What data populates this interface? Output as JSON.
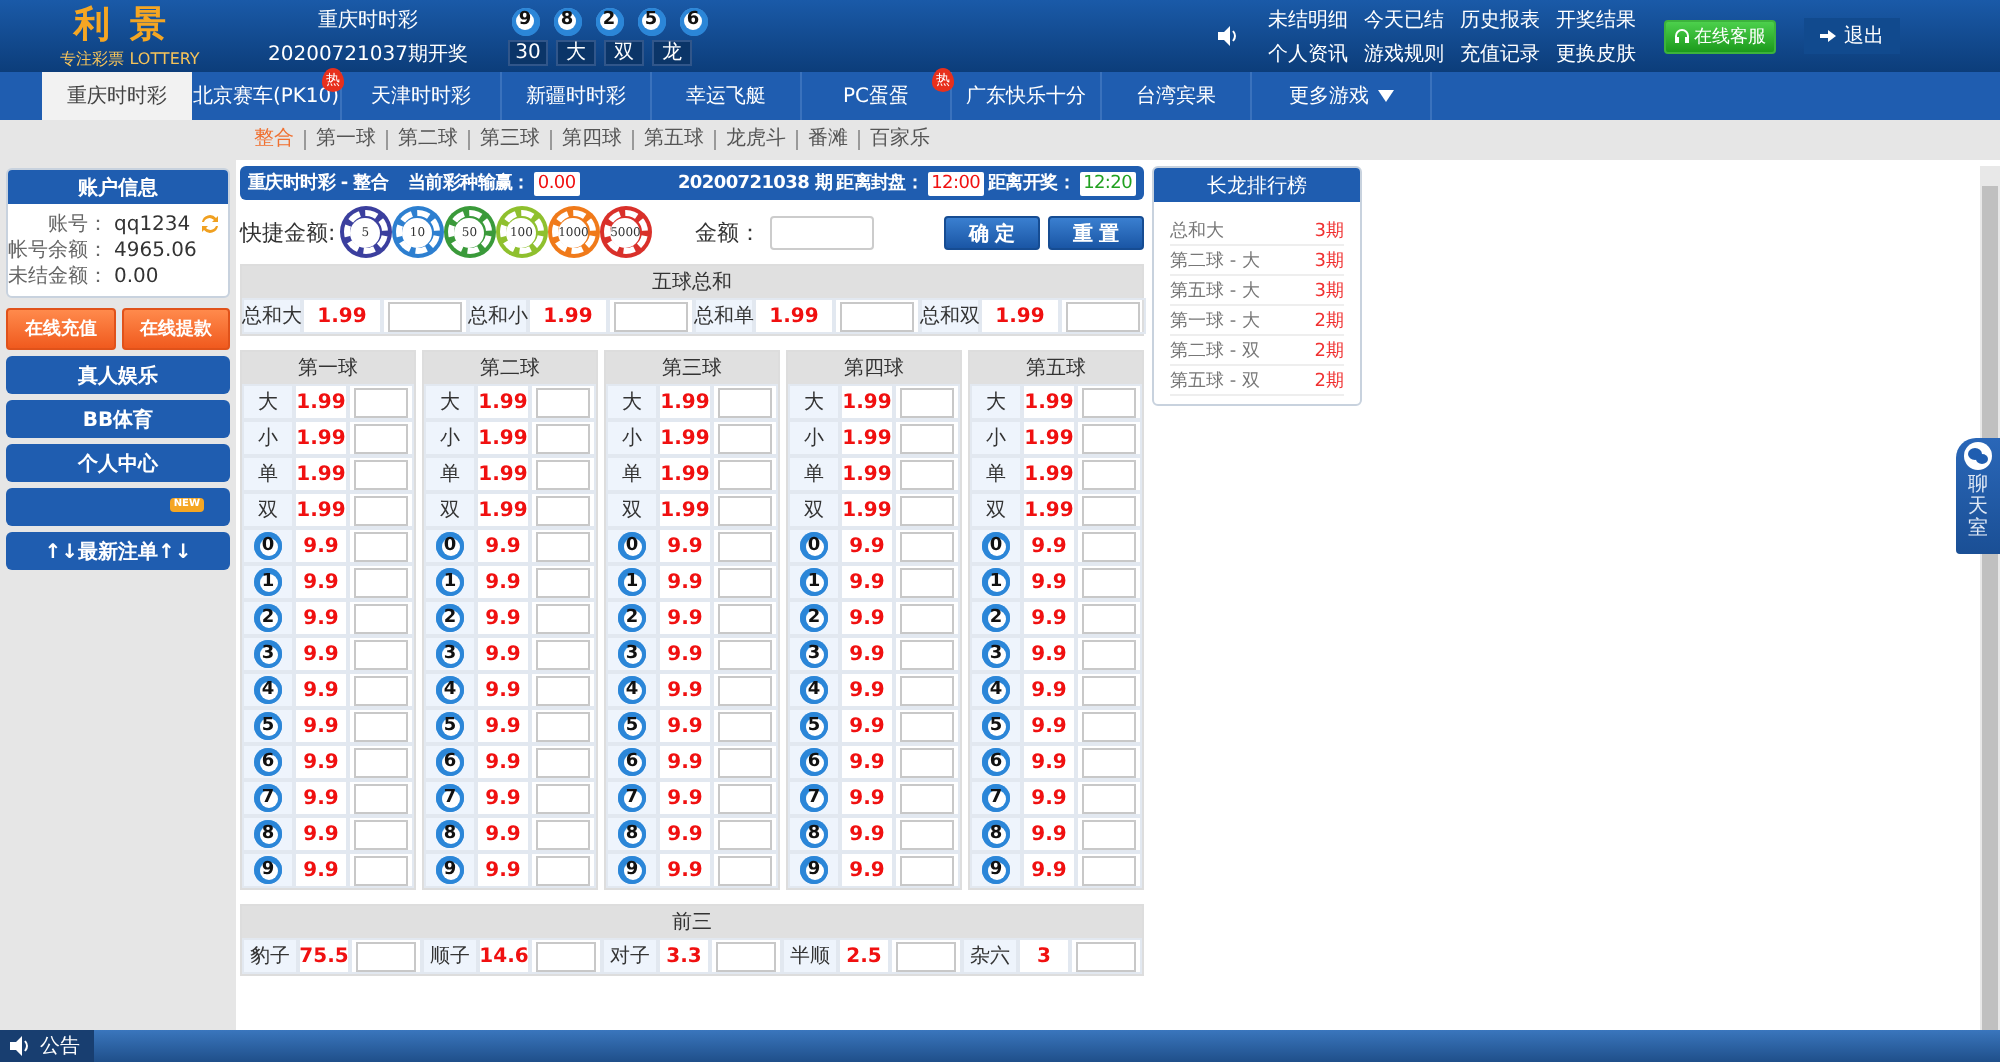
{
  "header": {
    "logo": {
      "title": "利景",
      "tagline": "专注彩票",
      "brand": "LOTTERY"
    },
    "draw": {
      "game": "重庆时时彩",
      "period": "20200721037期开奖",
      "balls": [
        "9",
        "8",
        "2",
        "5",
        "6"
      ],
      "results": [
        "30",
        "大",
        "双",
        "龙"
      ]
    },
    "links": [
      "未结明细",
      "今天已结",
      "历史报表",
      "开奖结果",
      "个人资讯",
      "游戏规则",
      "充值记录",
      "更换皮肤"
    ],
    "service_button": "在线客服",
    "logout_button": "退出"
  },
  "nav": [
    {
      "label": "重庆时时彩",
      "selected": true
    },
    {
      "label": "北京赛车(PK10)",
      "selected": false,
      "badge": "热"
    },
    {
      "label": "天津时时彩",
      "selected": false
    },
    {
      "label": "新疆时时彩",
      "selected": false
    },
    {
      "label": "幸运飞艇",
      "selected": false
    },
    {
      "label": "PC蛋蛋",
      "selected": false,
      "badge": "热"
    },
    {
      "label": "广东快乐十分",
      "selected": false
    },
    {
      "label": "台湾宾果",
      "selected": false
    },
    {
      "label": "更多游戏",
      "selected": false,
      "dropdown": true
    }
  ],
  "subnav": [
    {
      "label": "整合",
      "selected": true
    },
    {
      "label": "第一球",
      "selected": false
    },
    {
      "label": "第二球",
      "selected": false
    },
    {
      "label": "第三球",
      "selected": false
    },
    {
      "label": "第四球",
      "selected": false
    },
    {
      "label": "第五球",
      "selected": false
    },
    {
      "label": "龙虎斗",
      "selected": false
    },
    {
      "label": "番滩",
      "selected": false
    },
    {
      "label": "百家乐",
      "selected": false
    }
  ],
  "sidebar": {
    "account": {
      "title": "账户信息",
      "rows": [
        {
          "label": "账号：",
          "value": "qq1234",
          "refresh": true
        },
        {
          "label": "帐号余额：",
          "value": "4965.06"
        },
        {
          "label": "未结金额：",
          "value": "0.00"
        }
      ]
    },
    "actions": [
      "在线充值",
      "在线提款"
    ],
    "menu": [
      {
        "label": "真人娱乐"
      },
      {
        "label": "BB体育"
      },
      {
        "label": "个人中心"
      },
      {
        "badge": "NEW"
      },
      {
        "label": "↑↓最新注单↑↓"
      }
    ]
  },
  "main": {
    "info_bar": {
      "game": "重庆时时彩 - 整合",
      "balance_label": "当前彩种输赢：",
      "balance": "0.00",
      "period": "20200721038 期",
      "close_label": "距离封盘：",
      "close_time": "12:00",
      "open_label": "距离开奖：",
      "open_time": "12:20"
    },
    "quick_amount": {
      "label": "快捷金额:",
      "chips": [
        {
          "value": "5",
          "color": "#3b3f9e"
        },
        {
          "value": "10",
          "color": "#2d7fd0"
        },
        {
          "value": "50",
          "color": "#3a9a3a"
        },
        {
          "value": "100",
          "color": "#8fc02e"
        },
        {
          "value": "1000",
          "color": "#f07a1a"
        },
        {
          "value": "5000",
          "color": "#d9302a"
        }
      ]
    },
    "amount": {
      "label": "金额："
    },
    "buttons": [
      "确 定",
      "重 置"
    ],
    "sum_section": {
      "title": "五球总和",
      "cells": [
        {
          "label": "总和大",
          "odds": "1.99"
        },
        {
          "label": "总和小",
          "odds": "1.99"
        },
        {
          "label": "总和单",
          "odds": "1.99"
        },
        {
          "label": "总和双",
          "odds": "1.99"
        }
      ]
    },
    "balls": [
      {
        "title": "第一球",
        "rows": [
          {
            "kind": "text",
            "label": "大",
            "odds": "1.99"
          },
          {
            "kind": "text",
            "label": "小",
            "odds": "1.99"
          },
          {
            "kind": "text",
            "label": "单",
            "odds": "1.99"
          },
          {
            "kind": "text",
            "label": "双",
            "odds": "1.99"
          },
          {
            "kind": "ball",
            "label": "0",
            "odds": "9.9"
          },
          {
            "kind": "ball",
            "label": "1",
            "odds": "9.9"
          },
          {
            "kind": "ball",
            "label": "2",
            "odds": "9.9"
          },
          {
            "kind": "ball",
            "label": "3",
            "odds": "9.9"
          },
          {
            "kind": "ball",
            "label": "4",
            "odds": "9.9"
          },
          {
            "kind": "ball",
            "label": "5",
            "odds": "9.9"
          },
          {
            "kind": "ball",
            "label": "6",
            "odds": "9.9"
          },
          {
            "kind": "ball",
            "label": "7",
            "odds": "9.9"
          },
          {
            "kind": "ball",
            "label": "8",
            "odds": "9.9"
          },
          {
            "kind": "ball",
            "label": "9",
            "odds": "9.9"
          }
        ]
      },
      {
        "title": "第二球",
        "rows": [
          {
            "kind": "text",
            "label": "大",
            "odds": "1.99"
          },
          {
            "kind": "text",
            "label": "小",
            "odds": "1.99"
          },
          {
            "kind": "text",
            "label": "单",
            "odds": "1.99"
          },
          {
            "kind": "text",
            "label": "双",
            "odds": "1.99"
          },
          {
            "kind": "ball",
            "label": "0",
            "odds": "9.9"
          },
          {
            "kind": "ball",
            "label": "1",
            "odds": "9.9"
          },
          {
            "kind": "ball",
            "label": "2",
            "odds": "9.9"
          },
          {
            "kind": "ball",
            "label": "3",
            "odds": "9.9"
          },
          {
            "kind": "ball",
            "label": "4",
            "odds": "9.9"
          },
          {
            "kind": "ball",
            "label": "5",
            "odds": "9.9"
          },
          {
            "kind": "ball",
            "label": "6",
            "odds": "9.9"
          },
          {
            "kind": "ball",
            "label": "7",
            "odds": "9.9"
          },
          {
            "kind": "ball",
            "label": "8",
            "odds": "9.9"
          },
          {
            "kind": "ball",
            "label": "9",
            "odds": "9.9"
          }
        ]
      },
      {
        "title": "第三球",
        "rows": [
          {
            "kind": "text",
            "label": "大",
            "odds": "1.99"
          },
          {
            "kind": "text",
            "label": "小",
            "odds": "1.99"
          },
          {
            "kind": "text",
            "label": "单",
            "odds": "1.99"
          },
          {
            "kind": "text",
            "label": "双",
            "odds": "1.99"
          },
          {
            "kind": "ball",
            "label": "0",
            "odds": "9.9"
          },
          {
            "kind": "ball",
            "label": "1",
            "odds": "9.9"
          },
          {
            "kind": "ball",
            "label": "2",
            "odds": "9.9"
          },
          {
            "kind": "ball",
            "label": "3",
            "odds": "9.9"
          },
          {
            "kind": "ball",
            "label": "4",
            "odds": "9.9"
          },
          {
            "kind": "ball",
            "label": "5",
            "odds": "9.9"
          },
          {
            "kind": "ball",
            "label": "6",
            "odds": "9.9"
          },
          {
            "kind": "ball",
            "label": "7",
            "odds": "9.9"
          },
          {
            "kind": "ball",
            "label": "8",
            "odds": "9.9"
          },
          {
            "kind": "ball",
            "label": "9",
            "odds": "9.9"
          }
        ]
      },
      {
        "title": "第四球",
        "rows": [
          {
            "kind": "text",
            "label": "大",
            "odds": "1.99"
          },
          {
            "kind": "text",
            "label": "小",
            "odds": "1.99"
          },
          {
            "kind": "text",
            "label": "单",
            "odds": "1.99"
          },
          {
            "kind": "text",
            "label": "双",
            "odds": "1.99"
          },
          {
            "kind": "ball",
            "label": "0",
            "odds": "9.9"
          },
          {
            "kind": "ball",
            "label": "1",
            "odds": "9.9"
          },
          {
            "kind": "ball",
            "label": "2",
            "odds": "9.9"
          },
          {
            "kind": "ball",
            "label": "3",
            "odds": "9.9"
          },
          {
            "kind": "ball",
            "label": "4",
            "odds": "9.9"
          },
          {
            "kind": "ball",
            "label": "5",
            "odds": "9.9"
          },
          {
            "kind": "ball",
            "label": "6",
            "odds": "9.9"
          },
          {
            "kind": "ball",
            "label": "7",
            "odds": "9.9"
          },
          {
            "kind": "ball",
            "label": "8",
            "odds": "9.9"
          },
          {
            "kind": "ball",
            "label": "9",
            "odds": "9.9"
          }
        ]
      },
      {
        "title": "第五球",
        "rows": [
          {
            "kind": "text",
            "label": "大",
            "odds": "1.99"
          },
          {
            "kind": "text",
            "label": "小",
            "odds": "1.99"
          },
          {
            "kind": "text",
            "label": "单",
            "odds": "1.99"
          },
          {
            "kind": "text",
            "label": "双",
            "odds": "1.99"
          },
          {
            "kind": "ball",
            "label": "0",
            "odds": "9.9"
          },
          {
            "kind": "ball",
            "label": "1",
            "odds": "9.9"
          },
          {
            "kind": "ball",
            "label": "2",
            "odds": "9.9"
          },
          {
            "kind": "ball",
            "label": "3",
            "odds": "9.9"
          },
          {
            "kind": "ball",
            "label": "4",
            "odds": "9.9"
          },
          {
            "kind": "ball",
            "label": "5",
            "odds": "9.9"
          },
          {
            "kind": "ball",
            "label": "6",
            "odds": "9.9"
          },
          {
            "kind": "ball",
            "label": "7",
            "odds": "9.9"
          },
          {
            "kind": "ball",
            "label": "8",
            "odds": "9.9"
          },
          {
            "kind": "ball",
            "label": "9",
            "odds": "9.9"
          }
        ]
      }
    ],
    "front_three": {
      "title": "前三",
      "cells": [
        {
          "label": "豹子",
          "odds": "75.5"
        },
        {
          "label": "顺子",
          "odds": "14.6"
        },
        {
          "label": "对子",
          "odds": "3.3"
        },
        {
          "label": "半顺",
          "odds": "2.5"
        },
        {
          "label": "杂六",
          "odds": "3"
        }
      ]
    }
  },
  "dragon_board": {
    "title": "长龙排行榜",
    "items": [
      {
        "label": "总和大",
        "count": "3期"
      },
      {
        "label": "第二球 - 大",
        "count": "3期"
      },
      {
        "label": "第五球 - 大",
        "count": "3期"
      },
      {
        "label": "第一球 - 大",
        "count": "2期"
      },
      {
        "label": "第二球 - 双",
        "count": "2期"
      },
      {
        "label": "第五球 - 双",
        "count": "2期"
      }
    ]
  },
  "chat": {
    "label": "聊天室"
  },
  "footer": {
    "notice": "公告"
  }
}
